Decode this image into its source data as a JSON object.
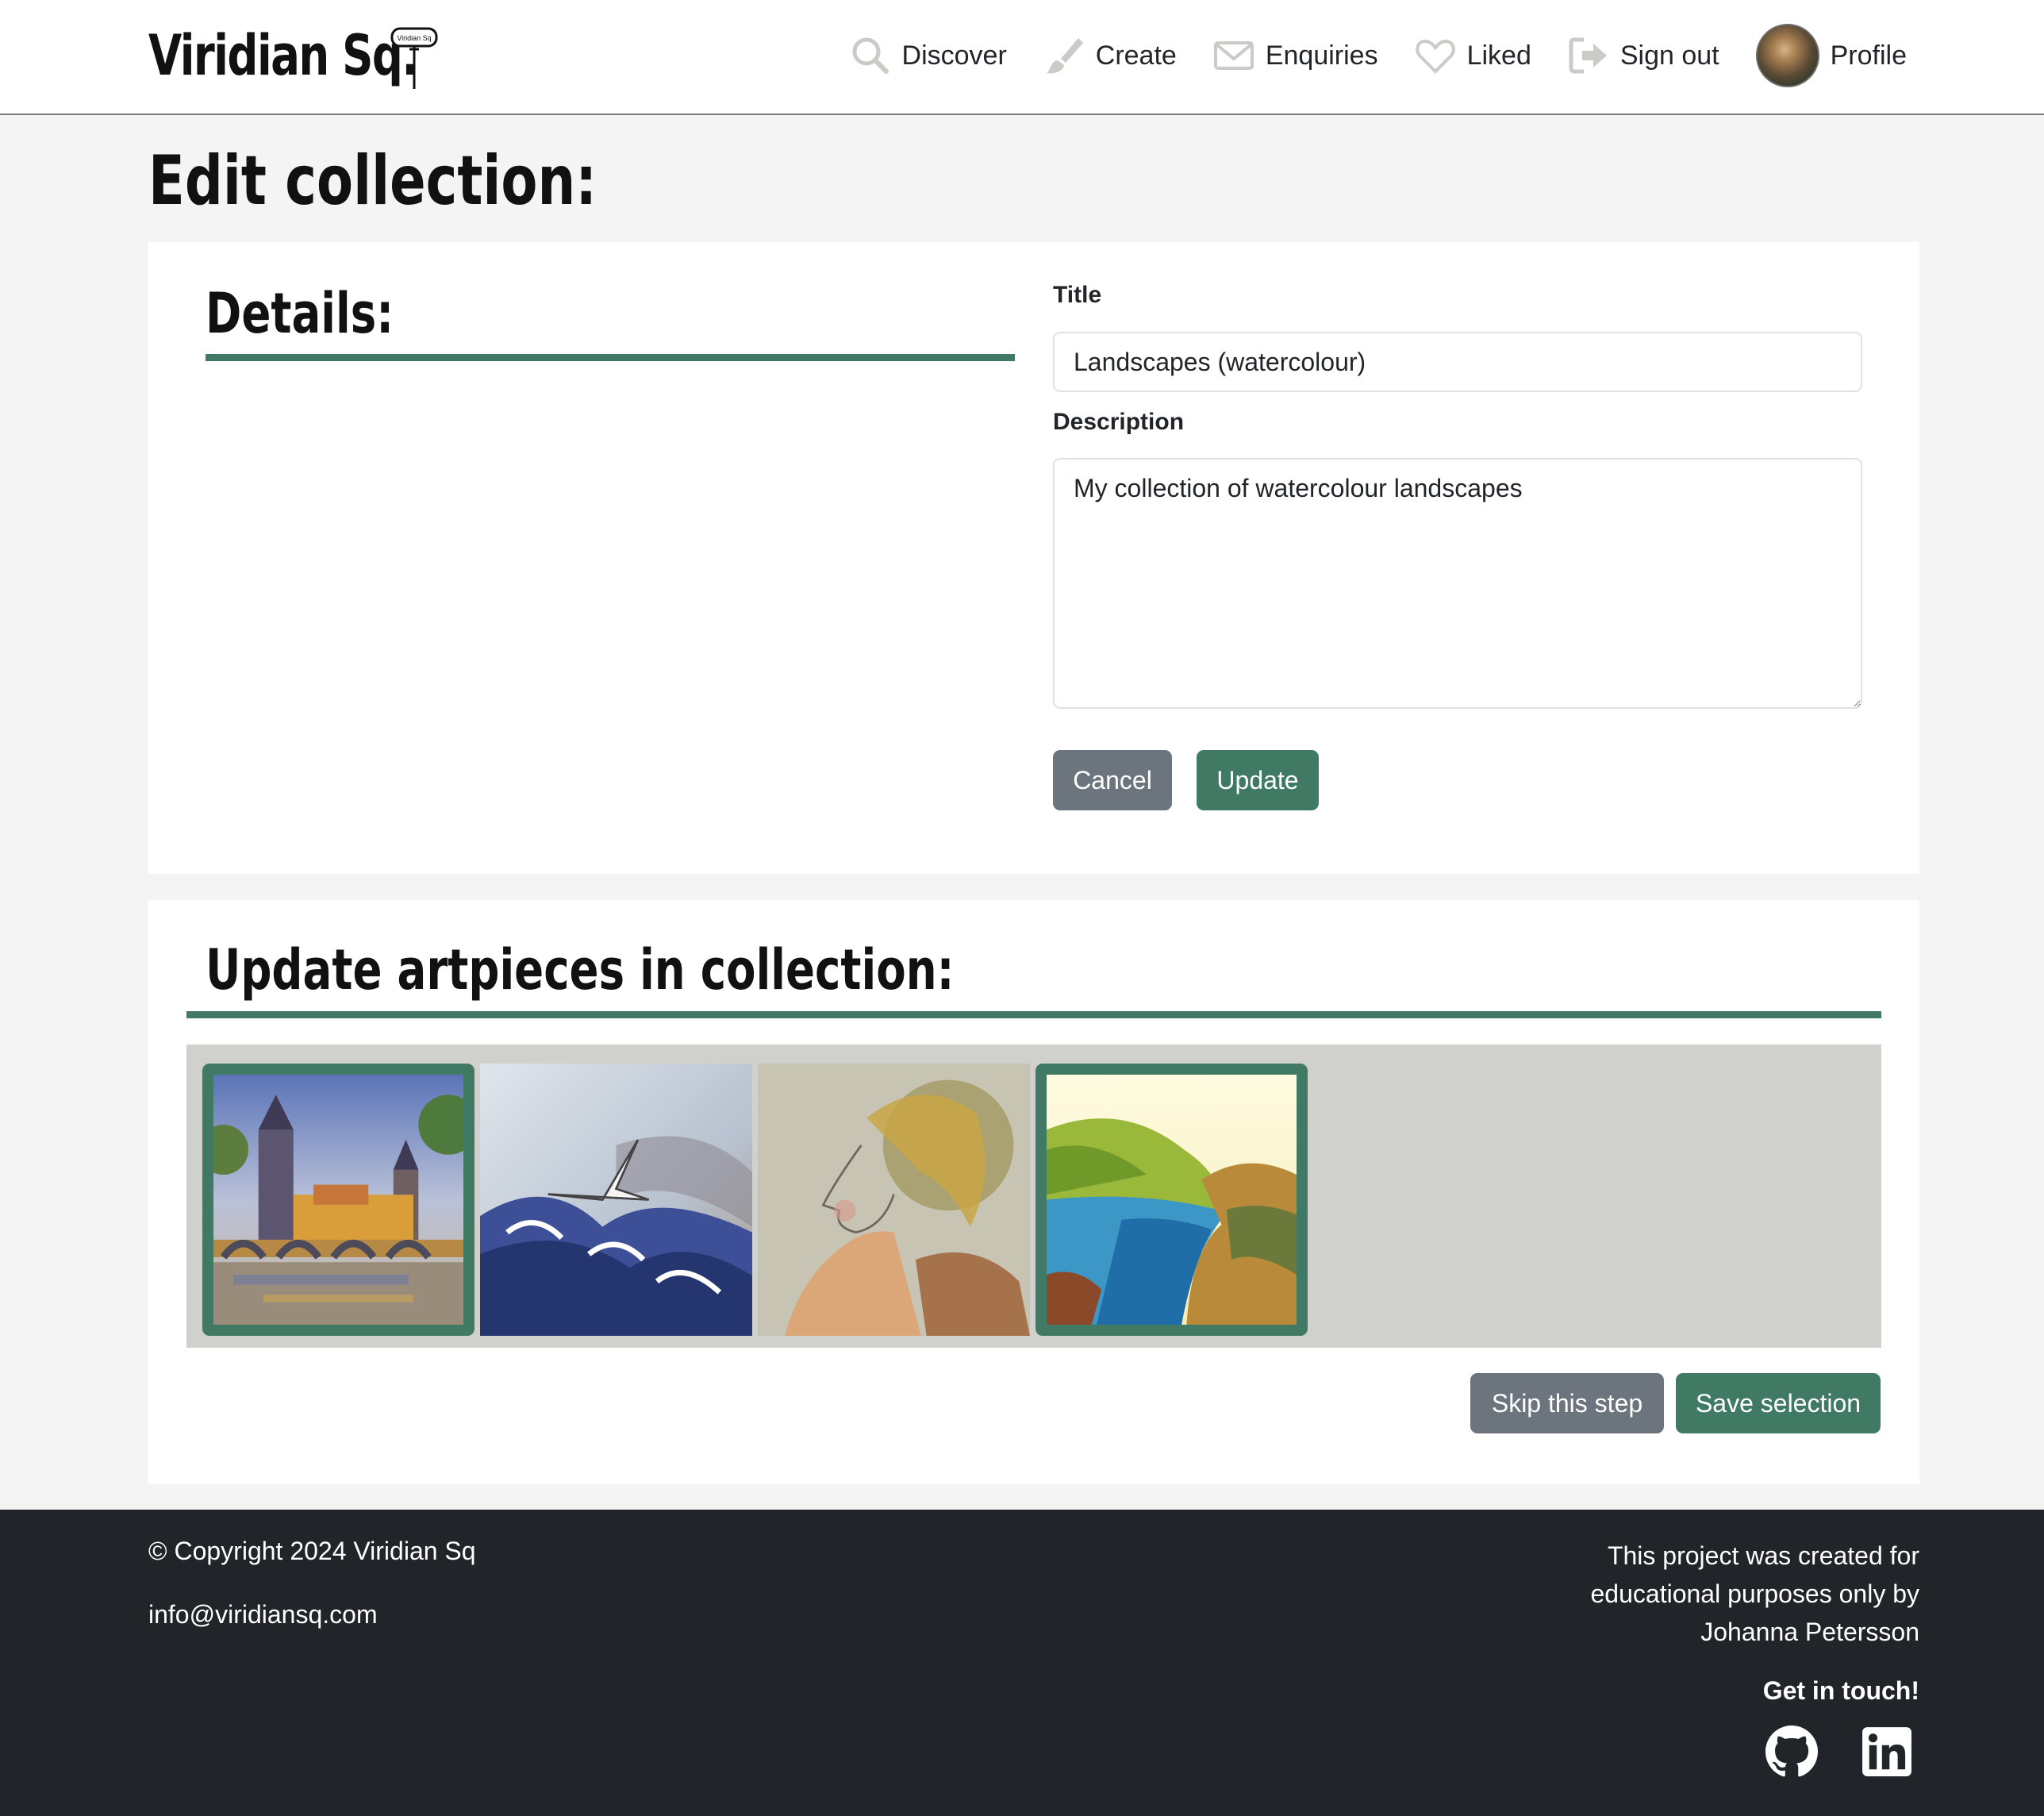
{
  "brand": {
    "name": "Viridian Sq.",
    "sign_text": "Viridian Sq"
  },
  "nav": {
    "discover": "Discover",
    "create": "Create",
    "enquiries": "Enquiries",
    "liked": "Liked",
    "signout": "Sign out",
    "profile": "Profile"
  },
  "page": {
    "title": "Edit collection:"
  },
  "details": {
    "heading": "Details:",
    "title_label": "Title",
    "title_value": "Landscapes (watercolour)",
    "description_label": "Description",
    "description_value": "My collection of watercolour landscapes",
    "cancel_label": "Cancel",
    "update_label": "Update"
  },
  "artpieces": {
    "heading": "Update artpieces in collection:",
    "items": [
      {
        "subject": "bridge-towers-painting",
        "selected": true
      },
      {
        "subject": "seagull-waves-painting",
        "selected": false
      },
      {
        "subject": "woman-portrait-sketch",
        "selected": false
      },
      {
        "subject": "coastal-inlet-painting",
        "selected": true
      }
    ],
    "skip_label": "Skip this step",
    "save_label": "Save selection"
  },
  "footer": {
    "copyright": "© Copyright 2024 Viridian Sq",
    "email": "info@viridiansq.com",
    "credit": "This project was created for educational purposes only by Johanna Petersson",
    "get_in_touch": "Get in touch!"
  },
  "colors": {
    "accent": "#417a64",
    "secondary": "#6c757d",
    "footer_bg": "#212529",
    "page_bg": "#f3f4f3"
  }
}
